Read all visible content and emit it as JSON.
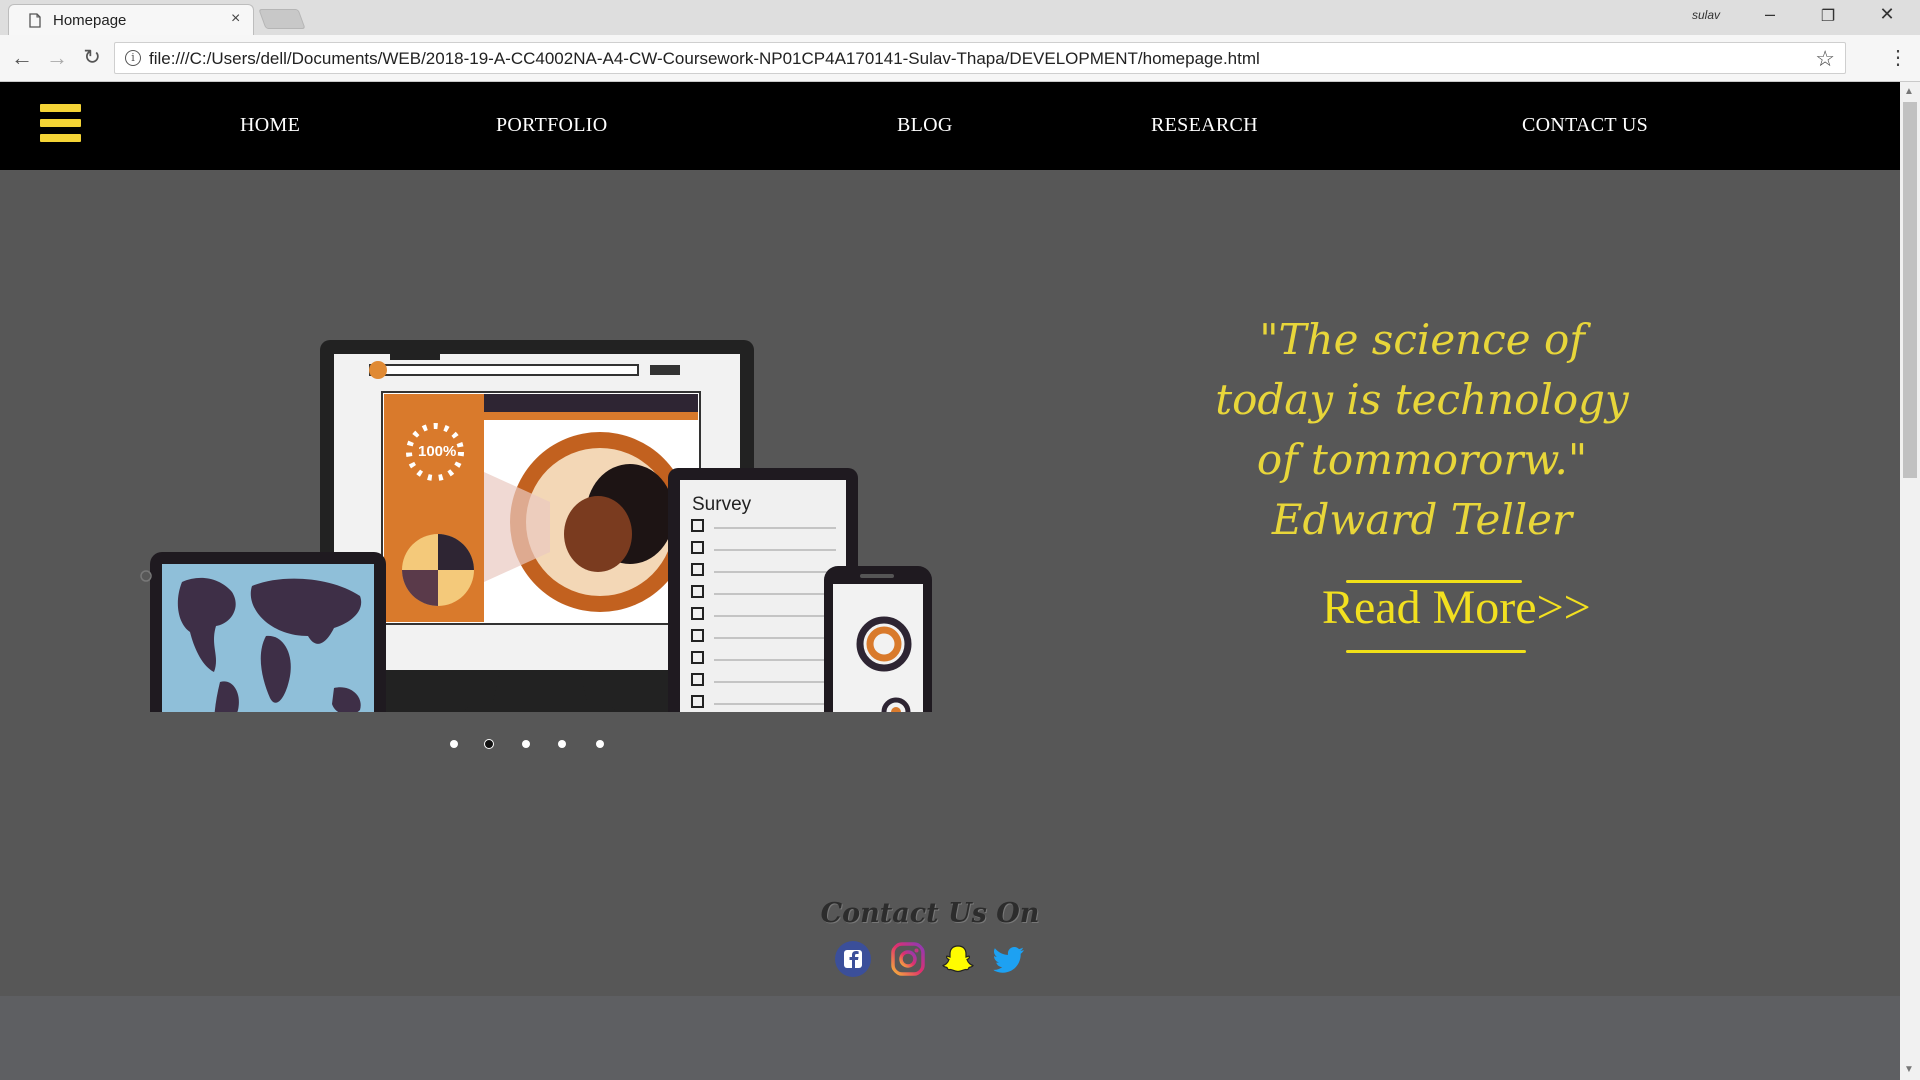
{
  "browser": {
    "tab_title": "Homepage",
    "tab_close": "×",
    "profile": "sulav",
    "url": "file:///C:/Users/dell/Documents/WEB/2018-19-A-CC4002NA-A4-CW-Coursework-NP01CP4A170141-Sulav-Thapa/DEVELOPMENT/homepage.html"
  },
  "nav": {
    "items": [
      {
        "label": "HOME"
      },
      {
        "label": "PORTFOLIO"
      },
      {
        "label": "BLOG"
      },
      {
        "label": "RESEARCH"
      },
      {
        "label": "CONTACT US"
      }
    ]
  },
  "illustration": {
    "survey_label": "Survey",
    "progress_label": "100%"
  },
  "slider": {
    "count": 5,
    "active_index": 1
  },
  "quote": {
    "line1": "\"The science of",
    "line2": "today is technology",
    "line3": "of tommororw.\"",
    "author": "Edward Teller",
    "read_more": "Read More>>"
  },
  "contact": {
    "title": "Contact Us On",
    "icons": [
      "facebook-icon",
      "instagram-icon",
      "snapchat-icon",
      "twitter-icon"
    ]
  },
  "colors": {
    "nav_bg": "#000000",
    "page_bg": "#575757",
    "accent_yellow": "#f4d436",
    "orange": "#d97a2c"
  }
}
